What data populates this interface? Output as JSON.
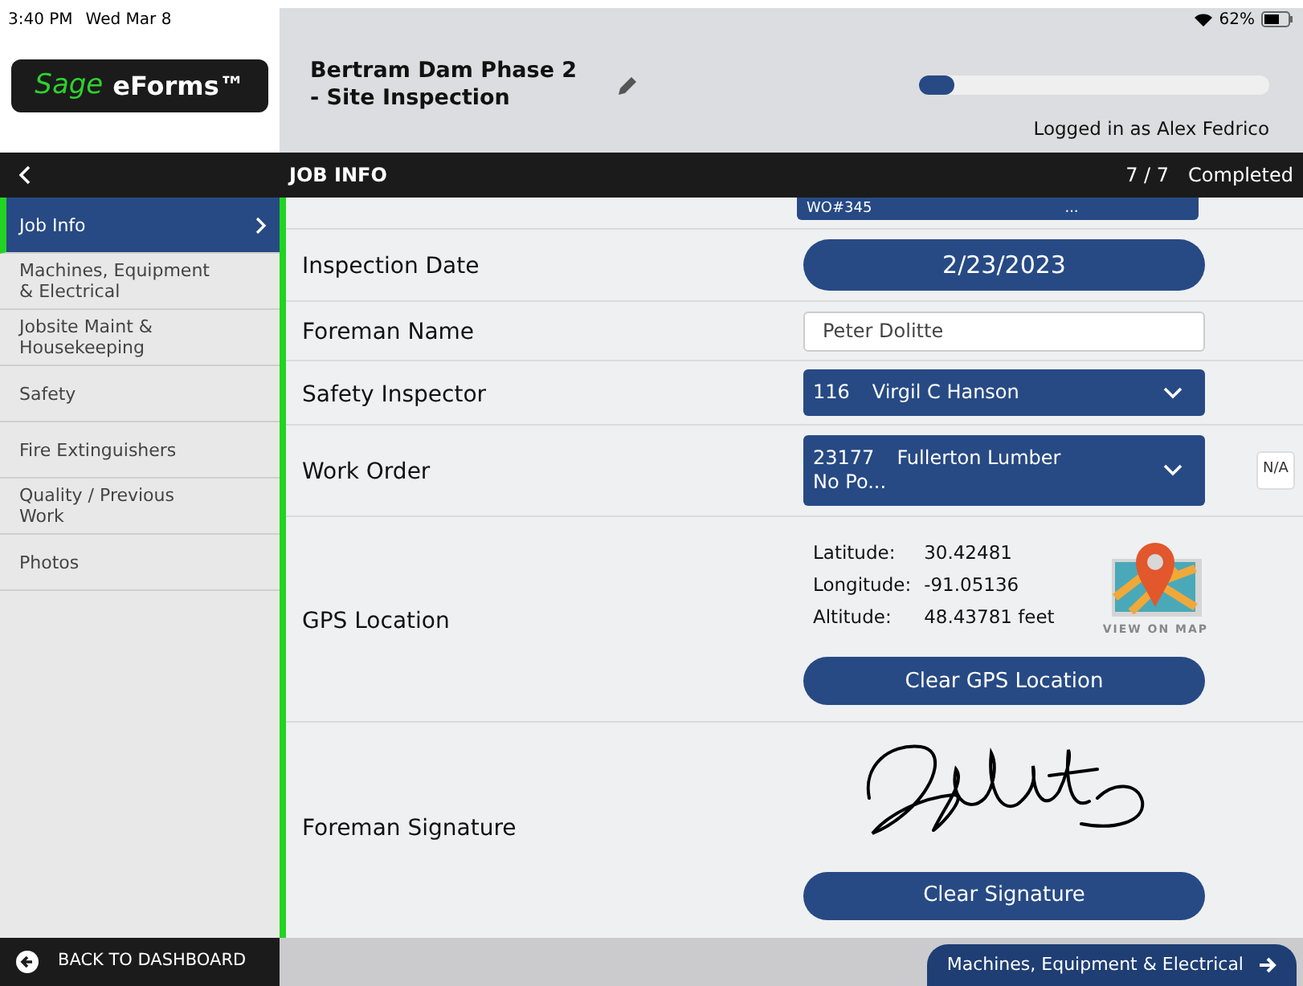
{
  "status_bar": {
    "time": "3:40 PM",
    "date": "Wed Mar 8",
    "battery": "62%"
  },
  "logo": {
    "brand": "Sage",
    "product": "eForms™"
  },
  "header": {
    "title": "Bertram Dam Phase 2 - Site Inspection",
    "progress": {
      "level": 0.1
    },
    "user": "Logged in as Alex Fedrico"
  },
  "nav_bar": {
    "title": "JOB INFO",
    "count": "7 / 7",
    "status": "Completed"
  },
  "sidebar": {
    "items": [
      {
        "label": "Job Info",
        "selected": true
      },
      {
        "label": "Machines, Equipment & Electrical",
        "selected": false
      },
      {
        "label": "Jobsite Maint & Housekeeping",
        "selected": false
      },
      {
        "label": "Safety",
        "selected": false
      },
      {
        "label": "Fire Extinguishers",
        "selected": false
      },
      {
        "label": "Quality / Previous Work",
        "selected": false
      },
      {
        "label": "Photos",
        "selected": false
      }
    ],
    "back": "BACK TO DASHBOARD"
  },
  "form": {
    "top_partial": {
      "code": "WO#345",
      "more": "..."
    },
    "fields": [
      {
        "kind": "date",
        "label": "Inspection Date",
        "value": "2/23/2023"
      },
      {
        "kind": "text",
        "label": "Foreman Name",
        "value": "Peter Dolitte"
      },
      {
        "kind": "select",
        "label": "Safety Inspector",
        "code": "116",
        "value": "Virgil C  Hanson"
      },
      {
        "kind": "select",
        "label": "Work Order",
        "code": "23177",
        "value": "Fullerton Lumber",
        "extra": "No Po...",
        "na": "N/A"
      },
      {
        "kind": "gps",
        "label": "GPS Location",
        "latitude": "30.42481",
        "longitude": "-91.05136",
        "altitude": "48.43781 feet",
        "lat_label": "Latitude:",
        "lon_label": "Longitude:",
        "alt_label": "Altitude:",
        "map_label": "VIEW ON MAP",
        "button": "Clear GPS Location"
      },
      {
        "kind": "signature",
        "label": "Foreman Signature",
        "button": "Clear Signature"
      }
    ]
  },
  "next_button": "Machines, Equipment & Electrical"
}
